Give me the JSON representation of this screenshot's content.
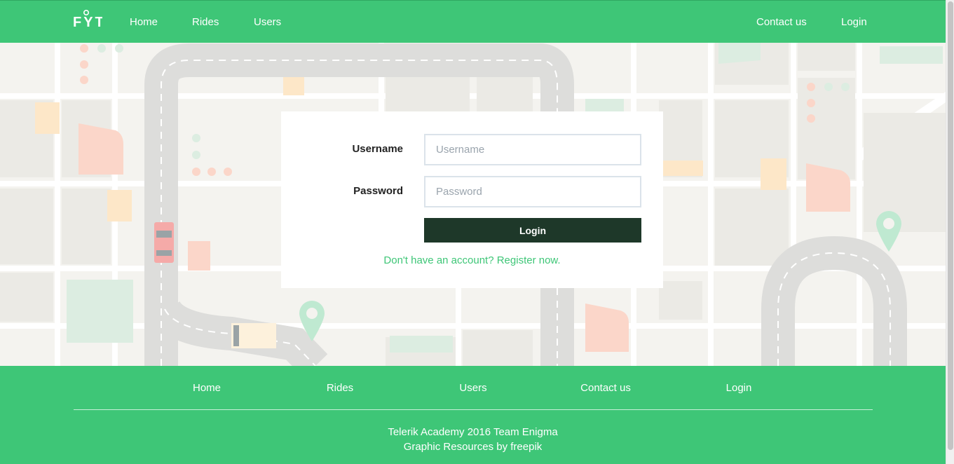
{
  "header": {
    "logo_text": "FYT",
    "nav": {
      "home": "Home",
      "rides": "Rides",
      "users": "Users",
      "contact": "Contact us",
      "login": "Login"
    }
  },
  "login_form": {
    "username_label": "Username",
    "username_placeholder": "Username",
    "username_value": "",
    "password_label": "Password",
    "password_placeholder": "Password",
    "password_value": "",
    "submit_label": "Login",
    "register_text": "Don't have an account? Register now."
  },
  "footer": {
    "nav": {
      "home": "Home",
      "rides": "Rides",
      "users": "Users",
      "contact": "Contact us",
      "login": "Login"
    },
    "credit_line1": "Telerik Academy 2016 Team Enigma",
    "credit_line2": "Graphic Resources by freepik"
  },
  "colors": {
    "brand_green": "#3ec677",
    "button_dark": "#1e3829",
    "map_background": "#f4f3ef"
  }
}
